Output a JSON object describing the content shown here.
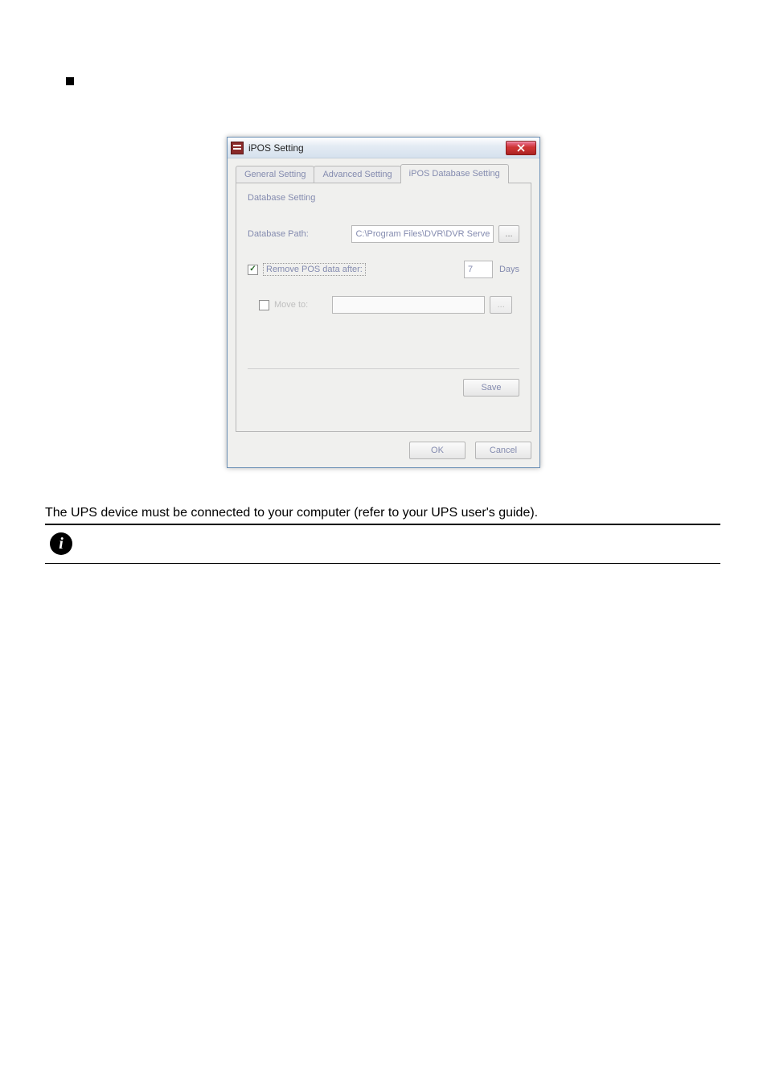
{
  "dialog": {
    "title": "iPOS Setting",
    "tabs": {
      "general": "General Setting",
      "advanced": "Advanced Setting",
      "database": "iPOS Database Setting"
    },
    "section_title": "Database Setting",
    "dbpath_label": "Database Path:",
    "dbpath_value": "C:\\Program Files\\DVR\\DVR Server\\POSDB",
    "browse_label": "...",
    "remove_label": "Remove POS data after:",
    "remove_days": "7",
    "days_unit": "Days",
    "moveto_label": "Move to:",
    "moveto_value": "",
    "save_label": "Save",
    "ok_label": "OK",
    "cancel_label": "Cancel"
  },
  "page": {
    "body_text": "The UPS device must be connected to your computer (refer to your UPS user's guide).",
    "info_glyph": "i"
  }
}
